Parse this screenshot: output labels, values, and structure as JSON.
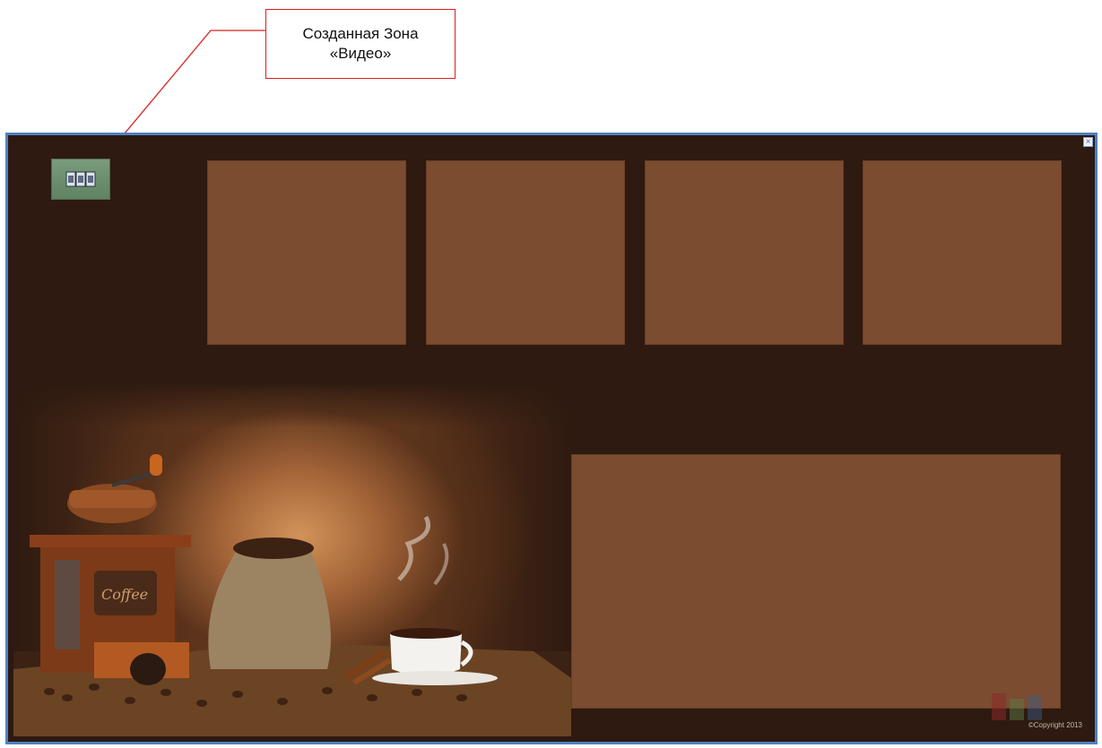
{
  "annotation": {
    "line1": "Созданная Зона",
    "line2": "«Видео»"
  },
  "canvas": {
    "close_glyph": "×",
    "video_zone_icon": "film-strip-icon",
    "copyright": "©Copyright 2013"
  },
  "colors": {
    "background": "#2e1a10",
    "zone_fill": "#7b4c30",
    "frame_border": "#4f81bd",
    "callout_border": "#d92020",
    "video_zone_fill": "#6f9170"
  }
}
